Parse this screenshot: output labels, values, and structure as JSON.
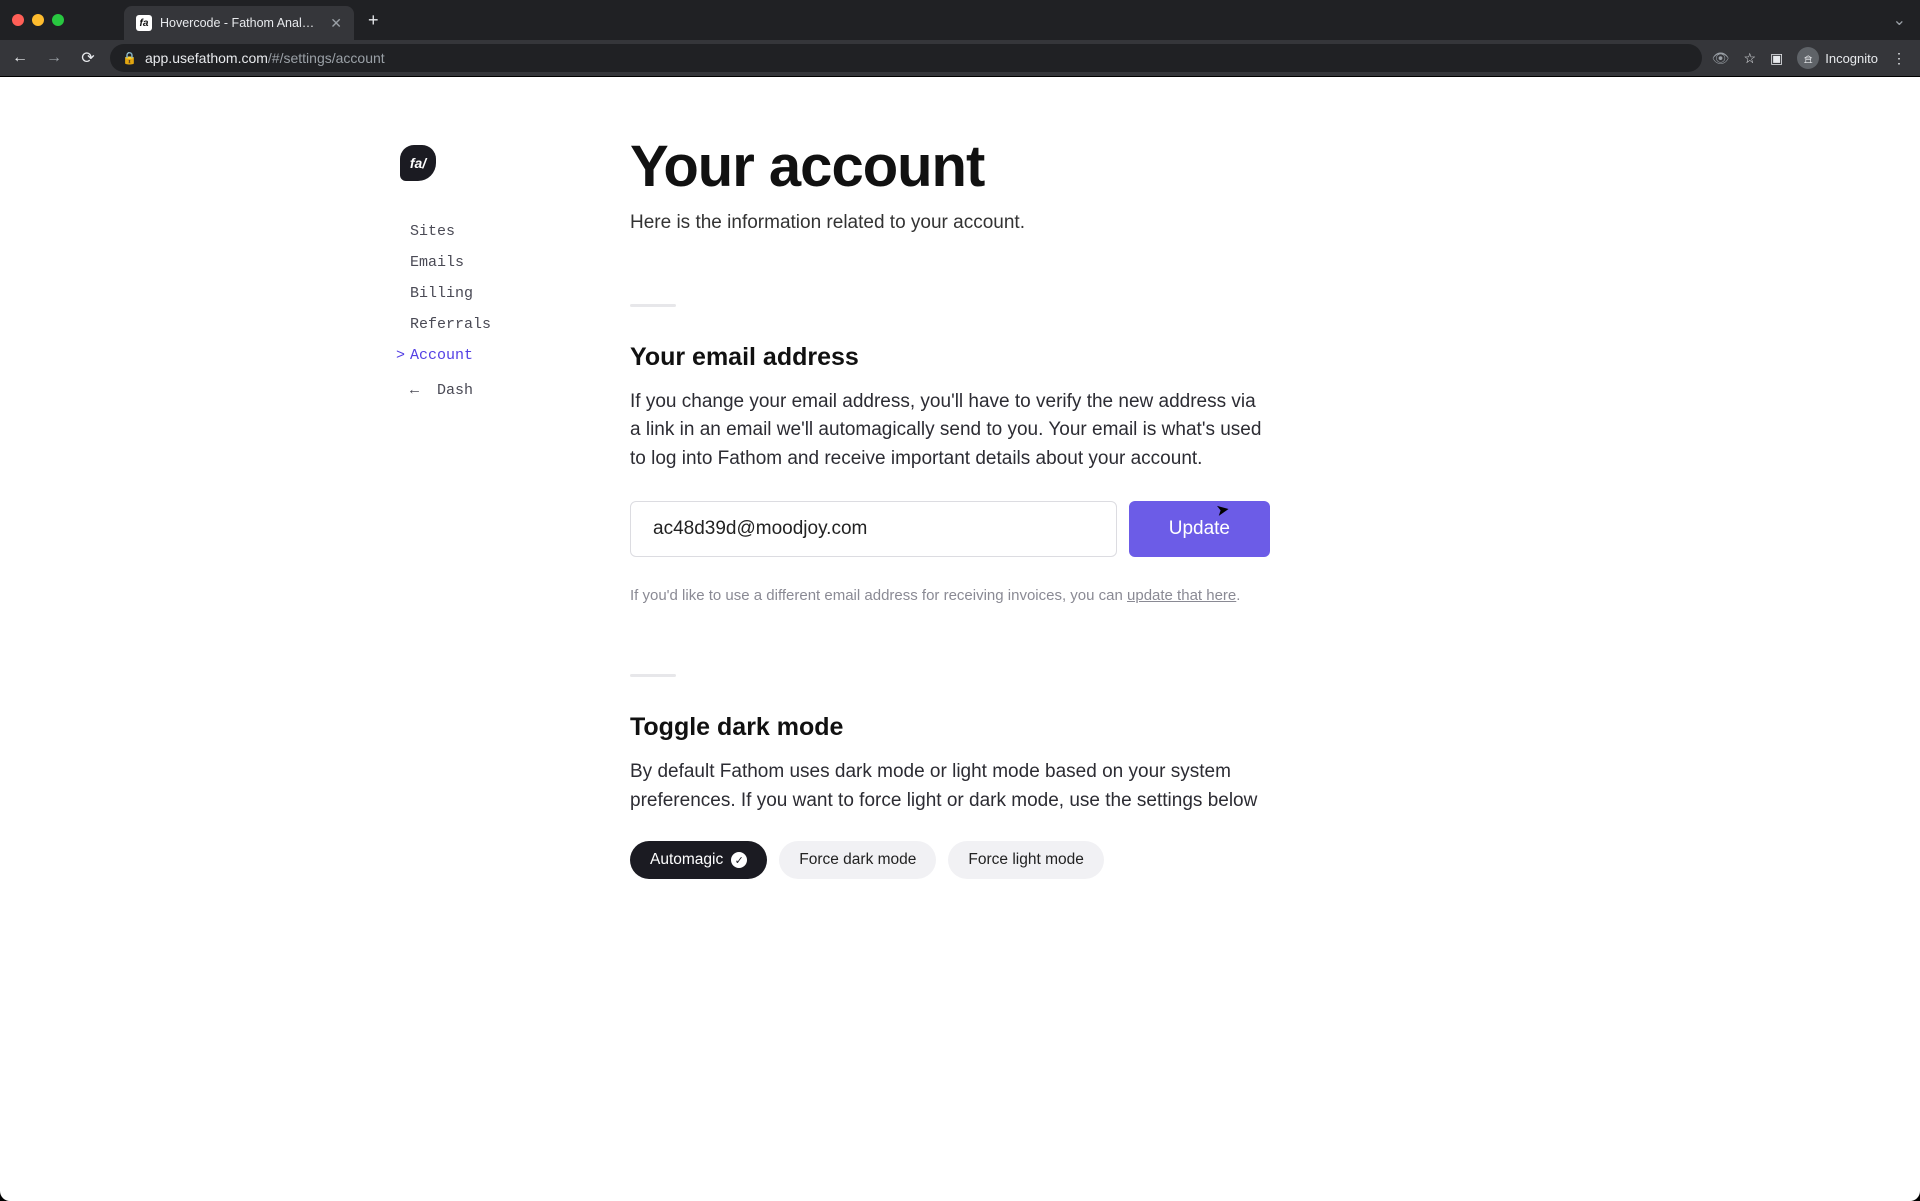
{
  "browser": {
    "tab_title": "Hovercode - Fathom Analytics",
    "favicon_text": "fa",
    "url_host": "app.usefathom.com",
    "url_path": "/#/settings/account",
    "incognito_label": "Incognito"
  },
  "sidebar": {
    "logo_text": "fa/",
    "items": [
      {
        "label": "Sites"
      },
      {
        "label": "Emails"
      },
      {
        "label": "Billing"
      },
      {
        "label": "Referrals"
      },
      {
        "label": "Account"
      },
      {
        "label": "Dash"
      }
    ]
  },
  "header": {
    "title": "Your account",
    "subtitle": "Here is the information related to your account."
  },
  "email_section": {
    "title": "Your email address",
    "body": "If you change your email address, you'll have to verify the new address via a link in an email we'll automagically send to you. Your email is what's used to log into Fathom and receive important details about your account.",
    "input_value": "ac48d39d@moodjoy.com",
    "update_label": "Update",
    "hint_prefix": "If you'd like to use a different email address for receiving invoices, you can ",
    "hint_link": "update that here",
    "hint_suffix": "."
  },
  "darkmode_section": {
    "title": "Toggle dark mode",
    "body": "By default Fathom uses dark mode or light mode based on your system preferences. If you want to force light or dark mode, use the settings below",
    "options": [
      {
        "label": "Automagic"
      },
      {
        "label": "Force dark mode"
      },
      {
        "label": "Force light mode"
      }
    ]
  }
}
